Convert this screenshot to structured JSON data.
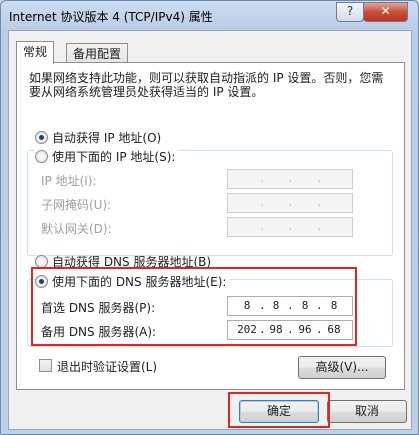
{
  "window": {
    "title": "Internet 协议版本 4 (TCP/IPv4) 属性",
    "help_glyph": "?",
    "close_glyph": "✕"
  },
  "tabs": [
    {
      "label": "常规",
      "active": true
    },
    {
      "label": "备用配置",
      "active": false
    }
  ],
  "description": "如果网络支持此功能，则可以获取自动指派的 IP 设置。否则，您需要从网络系统管理员处获得适当的 IP 设置。",
  "ip_section": {
    "auto_label": "自动获得 IP 地址(O)",
    "auto_selected": true,
    "manual_label": "使用下面的 IP 地址(S):",
    "manual_selected": false,
    "fields": [
      {
        "label": "IP 地址(I):",
        "value": ""
      },
      {
        "label": "子网掩码(U):",
        "value": ""
      },
      {
        "label": "默认网关(D):",
        "value": ""
      }
    ]
  },
  "dns_section": {
    "auto_label": "自动获得 DNS 服务器地址(B)",
    "auto_selected": false,
    "manual_label": "使用下面的 DNS 服务器地址(E):",
    "manual_selected": true,
    "preferred_label": "首选 DNS 服务器(P):",
    "preferred": [
      "8",
      "8",
      "8",
      "8"
    ],
    "alternate_label": "备用 DNS 服务器(A):",
    "alternate": [
      "202",
      "98",
      "96",
      "68"
    ]
  },
  "validate_label": "退出时验证设置(L)",
  "validate_checked": false,
  "buttons": {
    "advanced": "高级(V)...",
    "ok": "确定",
    "cancel": "取消"
  },
  "highlight_color": "#e3241f"
}
